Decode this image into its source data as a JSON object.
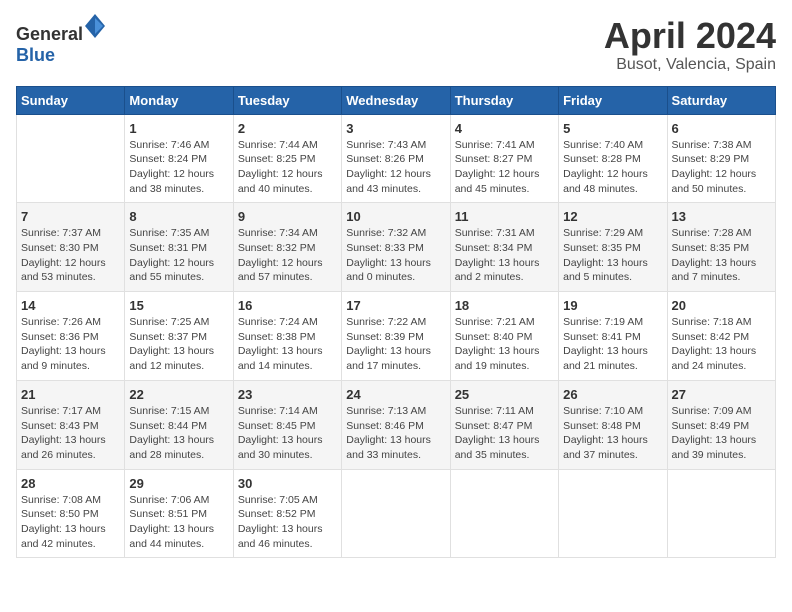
{
  "header": {
    "logo_general": "General",
    "logo_blue": "Blue",
    "title": "April 2024",
    "subtitle": "Busot, Valencia, Spain"
  },
  "days_of_week": [
    "Sunday",
    "Monday",
    "Tuesday",
    "Wednesday",
    "Thursday",
    "Friday",
    "Saturday"
  ],
  "weeks": [
    [
      {
        "date": "",
        "sunrise": "",
        "sunset": "",
        "daylight": ""
      },
      {
        "date": "1",
        "sunrise": "Sunrise: 7:46 AM",
        "sunset": "Sunset: 8:24 PM",
        "daylight": "Daylight: 12 hours and 38 minutes."
      },
      {
        "date": "2",
        "sunrise": "Sunrise: 7:44 AM",
        "sunset": "Sunset: 8:25 PM",
        "daylight": "Daylight: 12 hours and 40 minutes."
      },
      {
        "date": "3",
        "sunrise": "Sunrise: 7:43 AM",
        "sunset": "Sunset: 8:26 PM",
        "daylight": "Daylight: 12 hours and 43 minutes."
      },
      {
        "date": "4",
        "sunrise": "Sunrise: 7:41 AM",
        "sunset": "Sunset: 8:27 PM",
        "daylight": "Daylight: 12 hours and 45 minutes."
      },
      {
        "date": "5",
        "sunrise": "Sunrise: 7:40 AM",
        "sunset": "Sunset: 8:28 PM",
        "daylight": "Daylight: 12 hours and 48 minutes."
      },
      {
        "date": "6",
        "sunrise": "Sunrise: 7:38 AM",
        "sunset": "Sunset: 8:29 PM",
        "daylight": "Daylight: 12 hours and 50 minutes."
      }
    ],
    [
      {
        "date": "7",
        "sunrise": "Sunrise: 7:37 AM",
        "sunset": "Sunset: 8:30 PM",
        "daylight": "Daylight: 12 hours and 53 minutes."
      },
      {
        "date": "8",
        "sunrise": "Sunrise: 7:35 AM",
        "sunset": "Sunset: 8:31 PM",
        "daylight": "Daylight: 12 hours and 55 minutes."
      },
      {
        "date": "9",
        "sunrise": "Sunrise: 7:34 AM",
        "sunset": "Sunset: 8:32 PM",
        "daylight": "Daylight: 12 hours and 57 minutes."
      },
      {
        "date": "10",
        "sunrise": "Sunrise: 7:32 AM",
        "sunset": "Sunset: 8:33 PM",
        "daylight": "Daylight: 13 hours and 0 minutes."
      },
      {
        "date": "11",
        "sunrise": "Sunrise: 7:31 AM",
        "sunset": "Sunset: 8:34 PM",
        "daylight": "Daylight: 13 hours and 2 minutes."
      },
      {
        "date": "12",
        "sunrise": "Sunrise: 7:29 AM",
        "sunset": "Sunset: 8:35 PM",
        "daylight": "Daylight: 13 hours and 5 minutes."
      },
      {
        "date": "13",
        "sunrise": "Sunrise: 7:28 AM",
        "sunset": "Sunset: 8:35 PM",
        "daylight": "Daylight: 13 hours and 7 minutes."
      }
    ],
    [
      {
        "date": "14",
        "sunrise": "Sunrise: 7:26 AM",
        "sunset": "Sunset: 8:36 PM",
        "daylight": "Daylight: 13 hours and 9 minutes."
      },
      {
        "date": "15",
        "sunrise": "Sunrise: 7:25 AM",
        "sunset": "Sunset: 8:37 PM",
        "daylight": "Daylight: 13 hours and 12 minutes."
      },
      {
        "date": "16",
        "sunrise": "Sunrise: 7:24 AM",
        "sunset": "Sunset: 8:38 PM",
        "daylight": "Daylight: 13 hours and 14 minutes."
      },
      {
        "date": "17",
        "sunrise": "Sunrise: 7:22 AM",
        "sunset": "Sunset: 8:39 PM",
        "daylight": "Daylight: 13 hours and 17 minutes."
      },
      {
        "date": "18",
        "sunrise": "Sunrise: 7:21 AM",
        "sunset": "Sunset: 8:40 PM",
        "daylight": "Daylight: 13 hours and 19 minutes."
      },
      {
        "date": "19",
        "sunrise": "Sunrise: 7:19 AM",
        "sunset": "Sunset: 8:41 PM",
        "daylight": "Daylight: 13 hours and 21 minutes."
      },
      {
        "date": "20",
        "sunrise": "Sunrise: 7:18 AM",
        "sunset": "Sunset: 8:42 PM",
        "daylight": "Daylight: 13 hours and 24 minutes."
      }
    ],
    [
      {
        "date": "21",
        "sunrise": "Sunrise: 7:17 AM",
        "sunset": "Sunset: 8:43 PM",
        "daylight": "Daylight: 13 hours and 26 minutes."
      },
      {
        "date": "22",
        "sunrise": "Sunrise: 7:15 AM",
        "sunset": "Sunset: 8:44 PM",
        "daylight": "Daylight: 13 hours and 28 minutes."
      },
      {
        "date": "23",
        "sunrise": "Sunrise: 7:14 AM",
        "sunset": "Sunset: 8:45 PM",
        "daylight": "Daylight: 13 hours and 30 minutes."
      },
      {
        "date": "24",
        "sunrise": "Sunrise: 7:13 AM",
        "sunset": "Sunset: 8:46 PM",
        "daylight": "Daylight: 13 hours and 33 minutes."
      },
      {
        "date": "25",
        "sunrise": "Sunrise: 7:11 AM",
        "sunset": "Sunset: 8:47 PM",
        "daylight": "Daylight: 13 hours and 35 minutes."
      },
      {
        "date": "26",
        "sunrise": "Sunrise: 7:10 AM",
        "sunset": "Sunset: 8:48 PM",
        "daylight": "Daylight: 13 hours and 37 minutes."
      },
      {
        "date": "27",
        "sunrise": "Sunrise: 7:09 AM",
        "sunset": "Sunset: 8:49 PM",
        "daylight": "Daylight: 13 hours and 39 minutes."
      }
    ],
    [
      {
        "date": "28",
        "sunrise": "Sunrise: 7:08 AM",
        "sunset": "Sunset: 8:50 PM",
        "daylight": "Daylight: 13 hours and 42 minutes."
      },
      {
        "date": "29",
        "sunrise": "Sunrise: 7:06 AM",
        "sunset": "Sunset: 8:51 PM",
        "daylight": "Daylight: 13 hours and 44 minutes."
      },
      {
        "date": "30",
        "sunrise": "Sunrise: 7:05 AM",
        "sunset": "Sunset: 8:52 PM",
        "daylight": "Daylight: 13 hours and 46 minutes."
      },
      {
        "date": "",
        "sunrise": "",
        "sunset": "",
        "daylight": ""
      },
      {
        "date": "",
        "sunrise": "",
        "sunset": "",
        "daylight": ""
      },
      {
        "date": "",
        "sunrise": "",
        "sunset": "",
        "daylight": ""
      },
      {
        "date": "",
        "sunrise": "",
        "sunset": "",
        "daylight": ""
      }
    ]
  ]
}
